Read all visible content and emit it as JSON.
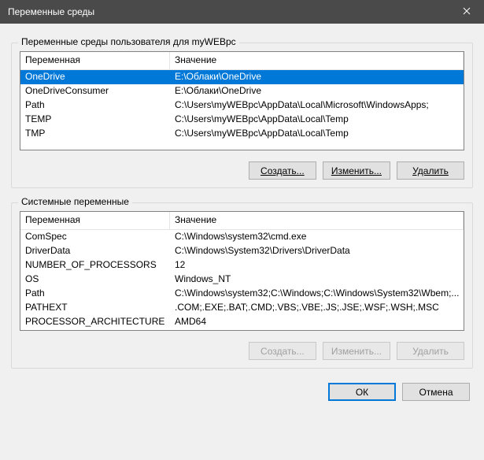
{
  "titlebar": {
    "title": "Переменные среды"
  },
  "user_group": {
    "label": "Переменные среды пользователя для myWEBpc",
    "columns": {
      "var": "Переменная",
      "val": "Значение"
    },
    "rows": [
      {
        "var": "OneDrive",
        "val": "E:\\Облаки\\OneDrive",
        "selected": true
      },
      {
        "var": "OneDriveConsumer",
        "val": "E:\\Облаки\\OneDrive",
        "selected": false
      },
      {
        "var": "Path",
        "val": "C:\\Users\\myWEBpc\\AppData\\Local\\Microsoft\\WindowsApps;",
        "selected": false
      },
      {
        "var": "TEMP",
        "val": "C:\\Users\\myWEBpc\\AppData\\Local\\Temp",
        "selected": false
      },
      {
        "var": "TMP",
        "val": "C:\\Users\\myWEBpc\\AppData\\Local\\Temp",
        "selected": false
      }
    ],
    "buttons": {
      "new": "Создать...",
      "edit": "Изменить...",
      "delete": "Удалить"
    }
  },
  "system_group": {
    "label": "Системные переменные",
    "columns": {
      "var": "Переменная",
      "val": "Значение"
    },
    "rows": [
      {
        "var": "ComSpec",
        "val": "C:\\Windows\\system32\\cmd.exe"
      },
      {
        "var": "DriverData",
        "val": "C:\\Windows\\System32\\Drivers\\DriverData"
      },
      {
        "var": "NUMBER_OF_PROCESSORS",
        "val": "12"
      },
      {
        "var": "OS",
        "val": "Windows_NT"
      },
      {
        "var": "Path",
        "val": "C:\\Windows\\system32;C:\\Windows;C:\\Windows\\System32\\Wbem;..."
      },
      {
        "var": "PATHEXT",
        "val": ".COM;.EXE;.BAT;.CMD;.VBS;.VBE;.JS;.JSE;.WSF;.WSH;.MSC"
      },
      {
        "var": "PROCESSOR_ARCHITECTURE",
        "val": "AMD64"
      }
    ],
    "buttons": {
      "new": "Создать...",
      "edit": "Изменить...",
      "delete": "Удалить"
    }
  },
  "dialog_buttons": {
    "ok": "ОК",
    "cancel": "Отмена"
  }
}
